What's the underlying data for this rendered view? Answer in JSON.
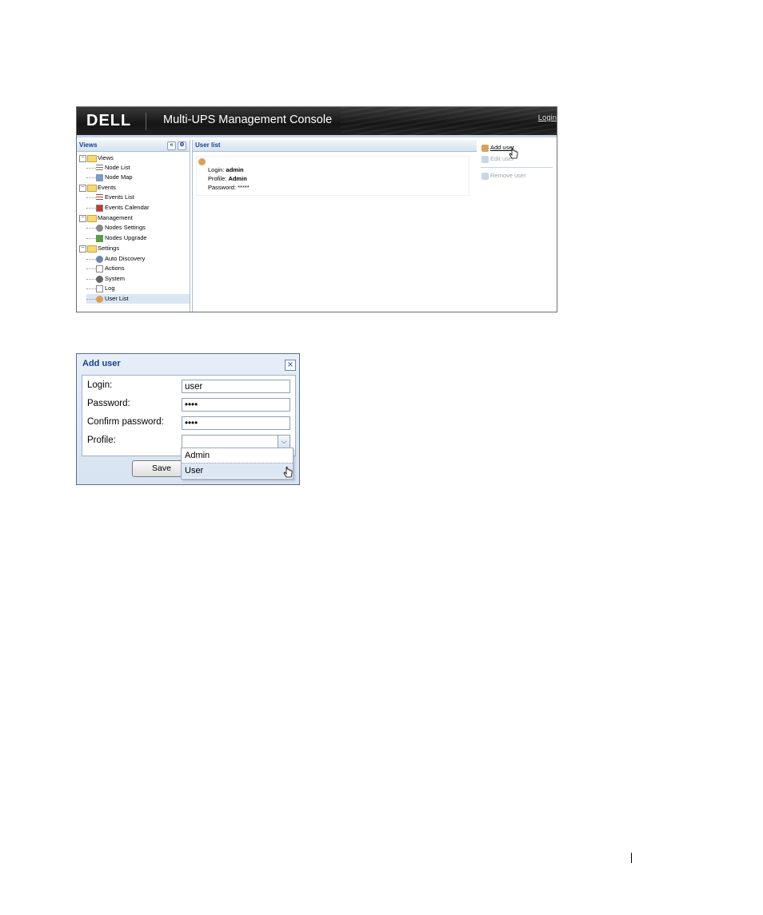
{
  "console": {
    "logo": "DELL",
    "title": "Multi-UPS Management Console",
    "login_link": "Login",
    "views": {
      "header": "Views",
      "collapse_btn": "«",
      "settings_btn": "⚙",
      "tree": [
        {
          "label": "Views",
          "type": "folder"
        },
        {
          "label": "Node List",
          "type": "leaf"
        },
        {
          "label": "Node Map",
          "type": "leaf"
        },
        {
          "label": "Events",
          "type": "folder"
        },
        {
          "label": "Events List",
          "type": "leaf"
        },
        {
          "label": "Events Calendar",
          "type": "leaf"
        },
        {
          "label": "Management",
          "type": "folder"
        },
        {
          "label": "Nodes Settings",
          "type": "leaf"
        },
        {
          "label": "Nodes Upgrade",
          "type": "leaf"
        },
        {
          "label": "Settings",
          "type": "folder"
        },
        {
          "label": "Auto Discovery",
          "type": "leaf"
        },
        {
          "label": "Actions",
          "type": "leaf"
        },
        {
          "label": "System",
          "type": "leaf"
        },
        {
          "label": "Log",
          "type": "leaf"
        },
        {
          "label": "User List",
          "type": "leaf",
          "selected": true
        }
      ]
    },
    "user_list": {
      "header": "User list",
      "login_label": "Login:",
      "login_value": "admin",
      "profile_label": "Profile:",
      "profile_value": "Admin",
      "password_label": "Password:",
      "password_value": "*****"
    },
    "actions": {
      "add_user": "Add user",
      "edit_user": "Edit user",
      "remove_user": "Remove user"
    }
  },
  "dialog": {
    "title": "Add user",
    "close": "×",
    "login_label": "Login:",
    "login_value": "user",
    "password_label": "Password:",
    "password_value": "••••",
    "confirm_label": "Confirm password:",
    "confirm_value": "••••",
    "profile_label": "Profile:",
    "profile_value": "",
    "profile_options": [
      "Admin",
      "User"
    ],
    "save_label": "Save"
  },
  "colors": {
    "header_bg": "#1e1e1e",
    "panel_title": "#15428b",
    "panel_border": "#a9bfd6"
  }
}
